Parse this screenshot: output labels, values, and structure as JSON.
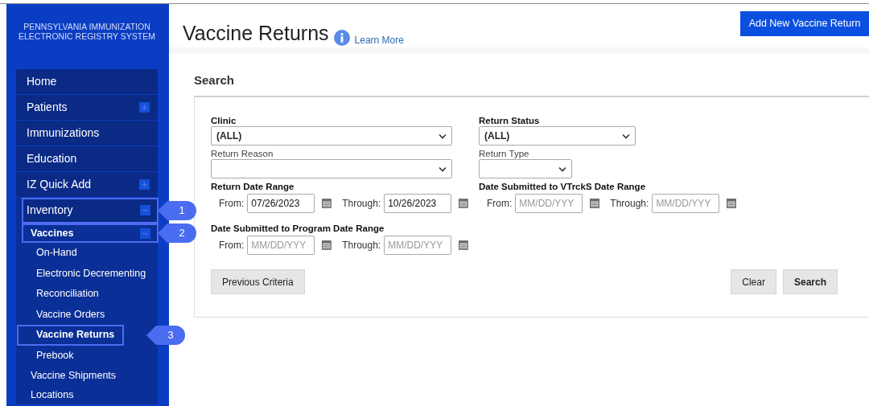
{
  "sidebar": {
    "title_lines": [
      "PENNSYLVANIA IMMUNIZATION",
      "ELECTRONIC REGISTRY SYSTEM"
    ],
    "items": [
      {
        "label": "Home",
        "active": false
      },
      {
        "label": "Patients",
        "active": false,
        "expanded": false
      },
      {
        "label": "Immunizations",
        "active": false
      },
      {
        "label": "Education",
        "active": false
      },
      {
        "label": "IZ Quick Add",
        "active": false,
        "expanded": false
      },
      {
        "label": "Inventory",
        "active": false,
        "expanded": true,
        "outlined": true,
        "callout": "1",
        "children": [
          {
            "label": "Vaccines",
            "active": true,
            "expanded": true,
            "outlined": true,
            "callout": "2",
            "children": [
              {
                "label": "On-Hand",
                "active": false
              },
              {
                "label": "Electronic Decrementing",
                "active": false
              },
              {
                "label": "Reconciliation",
                "active": false
              },
              {
                "label": "Vaccine Orders",
                "active": false
              },
              {
                "label": "Vaccine Returns",
                "active": true,
                "outlined": true,
                "callout": "3"
              },
              {
                "label": "Prebook",
                "active": false
              }
            ]
          },
          {
            "label": "Vaccine Shipments",
            "active": false
          },
          {
            "label": "Locations",
            "active": false
          }
        ]
      }
    ]
  },
  "header": {
    "title": "Vaccine Returns",
    "learn_more": "Learn More",
    "add_button": "Add New Vaccine Return"
  },
  "search": {
    "title": "Search",
    "columns": [
      [
        {
          "kind": "select",
          "label": "Clinic",
          "label_bold": true,
          "value": "(ALL)"
        },
        {
          "kind": "select",
          "label": "Return Reason",
          "label_bold": false
        },
        {
          "kind": "date_range",
          "label": "Return Date Range",
          "from_label": "From:",
          "from_value": "07/26/2023",
          "through_label": "Through:",
          "through_value": "10/26/2023"
        },
        {
          "kind": "date_range",
          "label": "Date Submitted to Program Date Range",
          "from_label": "From:",
          "from_placeholder": "MM/DD/YYY",
          "through_label": "Through:",
          "through_placeholder": "MM/DD/YYY"
        }
      ],
      [
        {
          "kind": "select",
          "label": "Return Status",
          "label_bold": true,
          "value": "(ALL)"
        },
        {
          "kind": "select",
          "label": "Return Type",
          "label_bold": false
        },
        {
          "kind": "date_range",
          "label": "Date Submitted to VTrckS Date Range",
          "from_label": "From:",
          "from_placeholder": "MM/DD/YYY",
          "through_label": "Through:",
          "through_placeholder": "MM/DD/YYY"
        }
      ]
    ],
    "left_buttons": [
      {
        "label": "Previous Criteria",
        "bold": false
      }
    ],
    "right_buttons": [
      {
        "label": "Clear",
        "bold": false
      },
      {
        "label": "Search",
        "bold": true
      }
    ]
  }
}
